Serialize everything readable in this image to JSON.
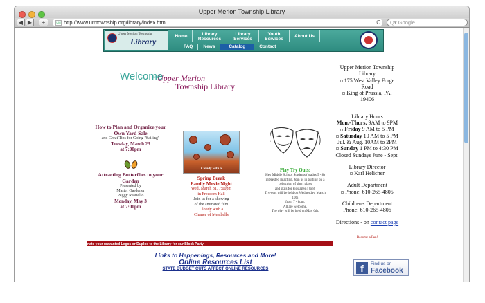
{
  "window": {
    "title": "Upper Merion Township Library",
    "nav_back": "◀",
    "nav_forward": "▶",
    "add_label": "+",
    "url": "http://www.umtownship.org/library/index.html",
    "reload": "C",
    "search_placeholder": "Google",
    "search_icon": "Q▾"
  },
  "banner": {
    "logo_text": "Library",
    "logo_sub": "Upper Merion Township",
    "top_nav": [
      "Home",
      "Library Resources",
      "Library Services",
      "Youth Services",
      "About Us"
    ],
    "bottom_nav": [
      "FAQ",
      "News",
      "Catalog",
      "Contact"
    ],
    "active_bottom": "Catalog"
  },
  "welcome": {
    "word": "Welcome",
    "to": "to the",
    "line1": "Upper Merion",
    "line2": "Township Library"
  },
  "events_left": {
    "e1_title": "How to Plan and Organize your Own Yard Sale",
    "e1_sub": "and Great Tips for Going \"Sailing\"",
    "e1_date": "Tuesday, March 23",
    "e1_time": "at 7:00pm",
    "e2_title": "Attracting Butterflies to your Garden",
    "e2_presented": "Presented by",
    "e2_p1": "Master Gardener",
    "e2_p2": "Peggy Rastiello",
    "e2_date": "Monday, May 3",
    "e2_time": "at 7:00pm"
  },
  "events_mid": {
    "title1": "Spring Break",
    "title2": "Family Movie Night",
    "date": "Wed. March 31, 7:00pm",
    "place": "in Freedom Hall",
    "join": "Join us for a showing",
    "of": "of the animated film",
    "film1": "Cloudy with a",
    "film2": "Chance of Meatballs"
  },
  "events_right": {
    "title": "Play Try Outs:",
    "lines": [
      "Hey Middle School Students (grades 5 - 8)",
      "interested in acting. Join us in putting on a",
      "collection of short plays",
      "and skits for kids ages 4 to 8.",
      "Try-outs will be held on Wednesday, March",
      "10th",
      "from 7 - 8pm.",
      "All are welcome.",
      "The play will be held on May 6th."
    ]
  },
  "sidebar": {
    "name1": "Upper Merion Township",
    "name2": "Library",
    "addr1": "175 West Valley Forge",
    "addr2": "Road",
    "addr3": "King of Prussia, PA.",
    "addr4": "19406",
    "hours_title": "Library Hours",
    "hours": [
      {
        "day": "Mon.-Thurs.",
        "time": " 9AM to 9PM"
      },
      {
        "day": "Friday",
        "time": " 9 AM to 5 PM"
      },
      {
        "day": "Saturday",
        "time": " 10 AM to 5 PM"
      },
      {
        "day": "",
        "time": "Jul. & Aug. 10AM to 2PM"
      },
      {
        "day": "Sunday",
        "time": " 1 PM to 4:30 PM"
      },
      {
        "day": "",
        "time": "Closed Sundays June - Sept."
      }
    ],
    "director_title": "Library Director",
    "director": "Karl Helicher",
    "adult_title": "Adult Department",
    "adult_phone": "Phone: 610-265-4805",
    "child_title": "Children's Department",
    "child_phone": "Phone: 610-265-4806",
    "directions_prefix": "Directions - on ",
    "directions_link": "contact page",
    "fan": "Become a Fan!"
  },
  "bottom": {
    "marquee": "nate your unwanted Legos or Duplos to the Library for our Block Party!",
    "links_title": "Links to Happenings, Resources and More!",
    "online": "Online Resources List",
    "budget": "STATE BUDGET CUTS AFFECT ONLINE RESOURCES",
    "fb_find": "Find us on",
    "fb_name": "Facebook",
    "fb_letter": "f"
  },
  "colors": {
    "banner": "#2e8c80",
    "accent_red": "#b3160f",
    "purple": "#8b1a5c",
    "teal": "#3aa69a"
  }
}
